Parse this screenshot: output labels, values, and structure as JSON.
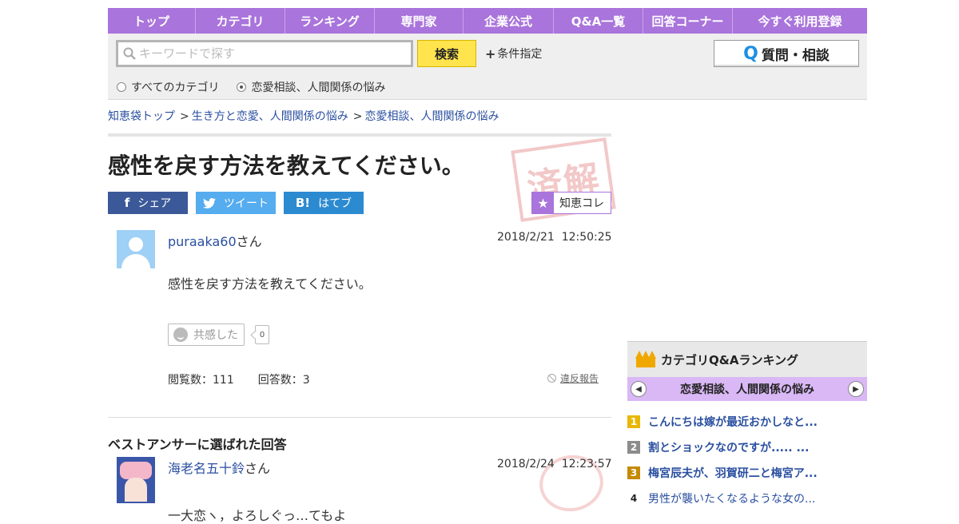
{
  "nav": {
    "items": [
      "トップ",
      "カテゴリ",
      "ランキング",
      "専門家",
      "企業公式",
      "Q&A一覧",
      "回答コーナー",
      "今すぐ利用登録"
    ]
  },
  "search": {
    "placeholder": "キーワードで探す",
    "button": "検索",
    "condition": "条件指定",
    "ask_button": "質問・相談",
    "scope_all": "すべてのカテゴリ",
    "scope_current": "恋愛相談、人間関係の悩み"
  },
  "breadcrumb": {
    "top": "知恵袋トップ",
    "sep": ">",
    "level1": "生き方と恋愛、人間関係の悩み",
    "level2": "恋愛相談、人間関係の悩み"
  },
  "question": {
    "title": "感性を戻す方法を教えてください。",
    "stamp": "済解",
    "share": {
      "facebook": "シェア",
      "twitter": "ツイート",
      "hatena": "はてブ",
      "facebook_icon": "f",
      "hatena_icon": "B!"
    },
    "chiecolle": "知恵コレ",
    "user": "puraaka60",
    "user_suffix": "さん",
    "date": "2018/2/21",
    "time": "12:50:25",
    "body": "感性を戻す方法を教えてください。",
    "kyokan_label": "共感した",
    "kyokan_count": "0",
    "views": "閲覧数：111",
    "answers": "回答数：3",
    "report": "違反報告"
  },
  "best_answer": {
    "heading": "ベストアンサーに選ばれた回答",
    "user": "海老名五十鈴",
    "user_suffix": "さん",
    "date": "2018/2/24",
    "time": "12:23:57",
    "body_cut": "一大恋ヽ，よろしぐっ…てもよ"
  },
  "ranking": {
    "title": "カテゴリQ&Aランキング",
    "category": "恋愛相談、人間関係の悩み",
    "items": [
      {
        "rank": "1",
        "text": "こんにちは嫁が最近おかしなと..."
      },
      {
        "rank": "2",
        "text": "割とショックなのですが..... ..."
      },
      {
        "rank": "3",
        "text": "梅宮辰夫が、羽賀研二と梅宮ア..."
      },
      {
        "rank": "4",
        "text": "男性が襲いたくなるような女の..."
      }
    ],
    "colors": {
      "gold": "#e8b800",
      "silver": "#8c8c8c",
      "bronze": "#c58a00"
    }
  },
  "colors": {
    "nav": "#a974db",
    "search_button": "#ffe44d",
    "link": "#2a4fa0",
    "facebook": "#3b5998",
    "twitter": "#55acee",
    "hatena": "#2c8ad0"
  }
}
